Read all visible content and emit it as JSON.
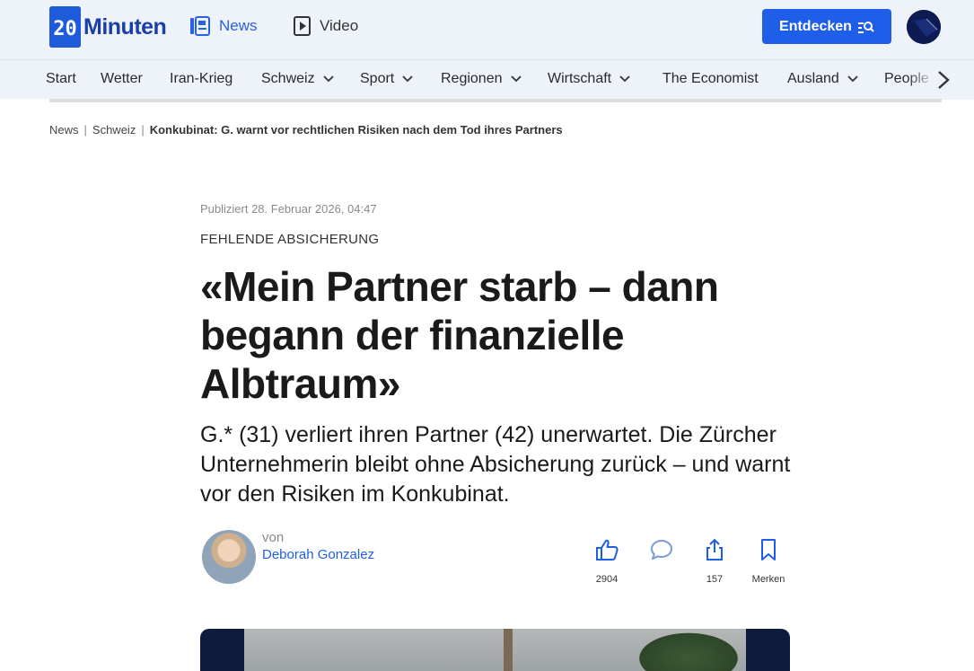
{
  "header": {
    "logo_text": "Minuten",
    "nav": [
      {
        "label": "News",
        "icon": "news-icon",
        "active": true
      },
      {
        "label": "Video",
        "icon": "video-icon",
        "active": false
      }
    ],
    "cta_label": "Entdecken",
    "accent_color": "#1f5ee8"
  },
  "categories": [
    {
      "label": "Start"
    },
    {
      "label": "Wetter"
    },
    {
      "label": "Iran-Krieg"
    },
    {
      "label": "Schweiz",
      "has_dropdown": true
    },
    {
      "label": "Sport",
      "has_dropdown": true
    },
    {
      "label": "Regionen",
      "has_dropdown": true
    },
    {
      "label": "Wirtschaft",
      "has_dropdown": true
    },
    {
      "label": "The Economist"
    },
    {
      "label": "Ausland",
      "has_dropdown": true
    },
    {
      "label": "People"
    }
  ],
  "breadcrumb": {
    "items": [
      "News",
      "Schweiz"
    ],
    "current": "Konkubinat: G. warnt vor rechtlichen Risiken nach dem Tod ihres Partners"
  },
  "article": {
    "published": "Publiziert 28. Februar 2026, 04:47",
    "kicker": "FEHLENDE ABSICHERUNG",
    "headline": "«Mein Partner starb – dann begann der finanzielle Albtraum»",
    "lead": "G.* (31) verliert ihren Partner (42) unerwartet. Die Zürcher Unternehmerin bleibt ohne Absicherung zurück – und warnt vor den Risiken im Konkubinat.",
    "author_prefix": "von",
    "author_name": "Deborah Gonzalez"
  },
  "actions": {
    "like_count": "2904",
    "comment_count": "",
    "share_count": "157",
    "bookmark_label": "Merken"
  }
}
